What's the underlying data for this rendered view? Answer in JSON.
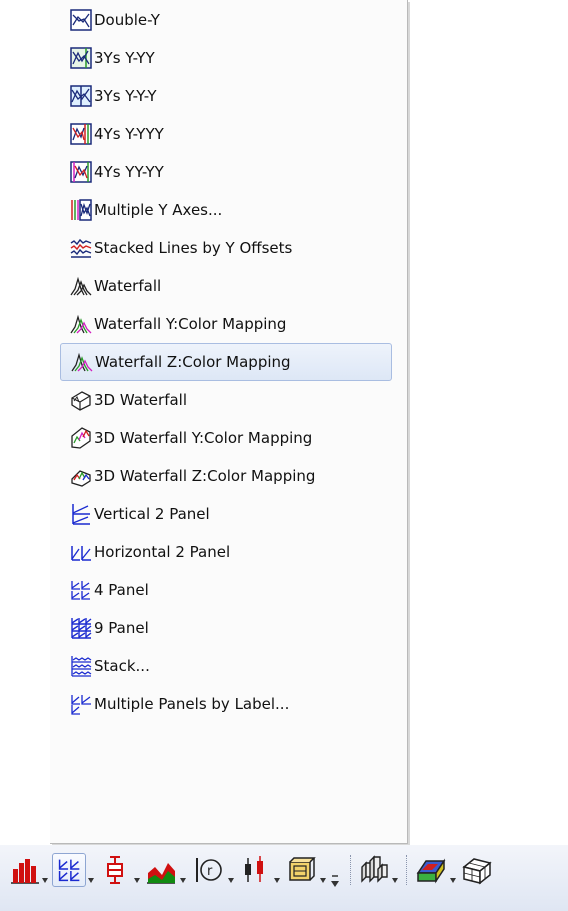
{
  "menu": {
    "items": [
      {
        "label": "Double-Y",
        "icon": "double-y-graph-icon"
      },
      {
        "label": "3Ys Y-YY",
        "icon": "three-ys-y-yy-graph-icon"
      },
      {
        "label": "3Ys Y-Y-Y",
        "icon": "three-ys-y-y-y-graph-icon"
      },
      {
        "label": "4Ys Y-YYY",
        "icon": "four-ys-y-yyy-graph-icon"
      },
      {
        "label": "4Ys YY-YY",
        "icon": "four-ys-yy-yy-graph-icon"
      },
      {
        "label": "Multiple Y Axes...",
        "icon": "multiple-y-axes-graph-icon"
      },
      {
        "label": "Stacked Lines by Y Offsets",
        "icon": "stacked-lines-graph-icon"
      },
      {
        "label": "Waterfall",
        "icon": "waterfall-graph-icon"
      },
      {
        "label": "Waterfall Y:Color Mapping",
        "icon": "waterfall-y-color-icon"
      },
      {
        "label": "Waterfall Z:Color Mapping",
        "icon": "waterfall-z-color-icon",
        "highlighted": true
      },
      {
        "label": "3D Waterfall",
        "icon": "3d-waterfall-icon"
      },
      {
        "label": "3D Waterfall Y:Color Mapping",
        "icon": "3d-waterfall-y-color-icon"
      },
      {
        "label": "3D Waterfall Z:Color Mapping",
        "icon": "3d-waterfall-z-color-icon"
      },
      {
        "label": "Vertical 2 Panel",
        "icon": "vertical-2-panel-icon"
      },
      {
        "label": "Horizontal 2 Panel",
        "icon": "horizontal-2-panel-icon"
      },
      {
        "label": "4 Panel",
        "icon": "4-panel-icon"
      },
      {
        "label": "9 Panel",
        "icon": "9-panel-icon"
      },
      {
        "label": "Stack...",
        "icon": "stack-panel-icon"
      },
      {
        "label": "Multiple Panels by Label...",
        "icon": "multiple-panels-by-label-icon"
      }
    ]
  },
  "toolbar": {
    "buttons": [
      {
        "icon": "column-chart-icon"
      },
      {
        "icon": "multi-panel-icon",
        "selected": true
      },
      {
        "icon": "box-chart-icon"
      },
      {
        "icon": "area-chart-icon"
      },
      {
        "icon": "polar-chart-icon"
      },
      {
        "icon": "stock-chart-icon"
      },
      {
        "icon": "contour-template-icon"
      },
      {
        "icon": "3d-bar-chart-icon"
      },
      {
        "icon": "3d-surface-icon"
      },
      {
        "icon": "3d-wireframe-icon"
      }
    ]
  },
  "colors": {
    "highlight_bg": "#dde7f6",
    "highlight_border": "#a9bde1",
    "toolbar_bg": "#e6ecf6"
  }
}
